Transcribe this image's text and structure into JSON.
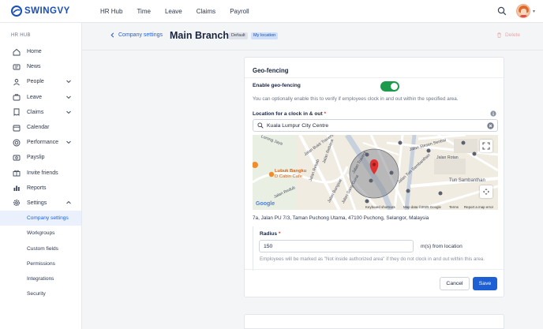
{
  "brand": {
    "name": "SWINGVY",
    "color": "#1a4fb8"
  },
  "topnav": [
    {
      "label": "HR Hub"
    },
    {
      "label": "Time"
    },
    {
      "label": "Leave"
    },
    {
      "label": "Claims"
    },
    {
      "label": "Payroll"
    }
  ],
  "sidebar": {
    "section": "HR HUB",
    "items": [
      {
        "label": "Home",
        "icon": "home-icon"
      },
      {
        "label": "News",
        "icon": "news-icon"
      },
      {
        "label": "People",
        "icon": "people-icon",
        "expandable": true
      },
      {
        "label": "Leave",
        "icon": "briefcase-icon",
        "expandable": true
      },
      {
        "label": "Claims",
        "icon": "receipt-icon",
        "expandable": true
      },
      {
        "label": "Calendar",
        "icon": "calendar-icon"
      },
      {
        "label": "Performance",
        "icon": "target-icon",
        "expandable": true
      },
      {
        "label": "Payslip",
        "icon": "payslip-icon"
      },
      {
        "label": "Invite friends",
        "icon": "gift-icon"
      },
      {
        "label": "Reports",
        "icon": "reports-icon"
      },
      {
        "label": "Settings",
        "icon": "gear-icon",
        "expanded": true
      }
    ],
    "settings_sub": [
      {
        "label": "Company settings",
        "active": true
      },
      {
        "label": "Workgroups"
      },
      {
        "label": "Custom fields"
      },
      {
        "label": "Permissions"
      },
      {
        "label": "Integrations"
      },
      {
        "label": "Security"
      }
    ]
  },
  "header": {
    "breadcrumb": "Company settings",
    "title": "Main Branch",
    "badge_default": "Default",
    "badge_mine": "My location",
    "delete_label": "Delete"
  },
  "geofencing": {
    "title": "Geo-fencing",
    "enable_label": "Enable geo-fencing",
    "enabled": true,
    "enable_help": "You can optionally enable this to verify if employees clock in and out within the specified area.",
    "location_label": "Location for a clock in & out",
    "location_required": "*",
    "location_value": "Kuala Lumpur City Centre",
    "map": {
      "poi_name": "Lubuk Bangku",
      "poi_sub": "D Cabin Cafe",
      "streets": [
        "Jalan Bukit Travers",
        "Jalan Travers",
        "Jalan Stesen Sentral",
        "Jalan Tun Sambanthan",
        "Tun Sambanthan",
        "Jalan Bangsar",
        "Jalan Rotan",
        "Jalan Sang Guna",
        "Jalan Rebab",
        "Jalan Redub",
        "Jalan Rebana",
        "Lorong Jaya"
      ],
      "google": "Google",
      "keyboard": "Keyboard shortcuts",
      "mapdata": "Map data ©2025 Google",
      "terms": "Terms",
      "report": "Report a map error"
    },
    "address": "7a, Jalan PU 7/3, Taman Puchong Utama, 47100 Puchong, Selangor, Malaysia",
    "radius_label": "Radius",
    "radius_required": "*",
    "radius_value": "150",
    "radius_unit": "m(s) from location",
    "radius_help": "Employees will be marked as \"Not inside authorized area\" if they do not clock in and out within this area.",
    "cancel_label": "Cancel",
    "save_label": "Save"
  },
  "colors": {
    "primary": "#1e60d4",
    "toggle_on": "#1d9a4b",
    "pin": "#e03131"
  }
}
